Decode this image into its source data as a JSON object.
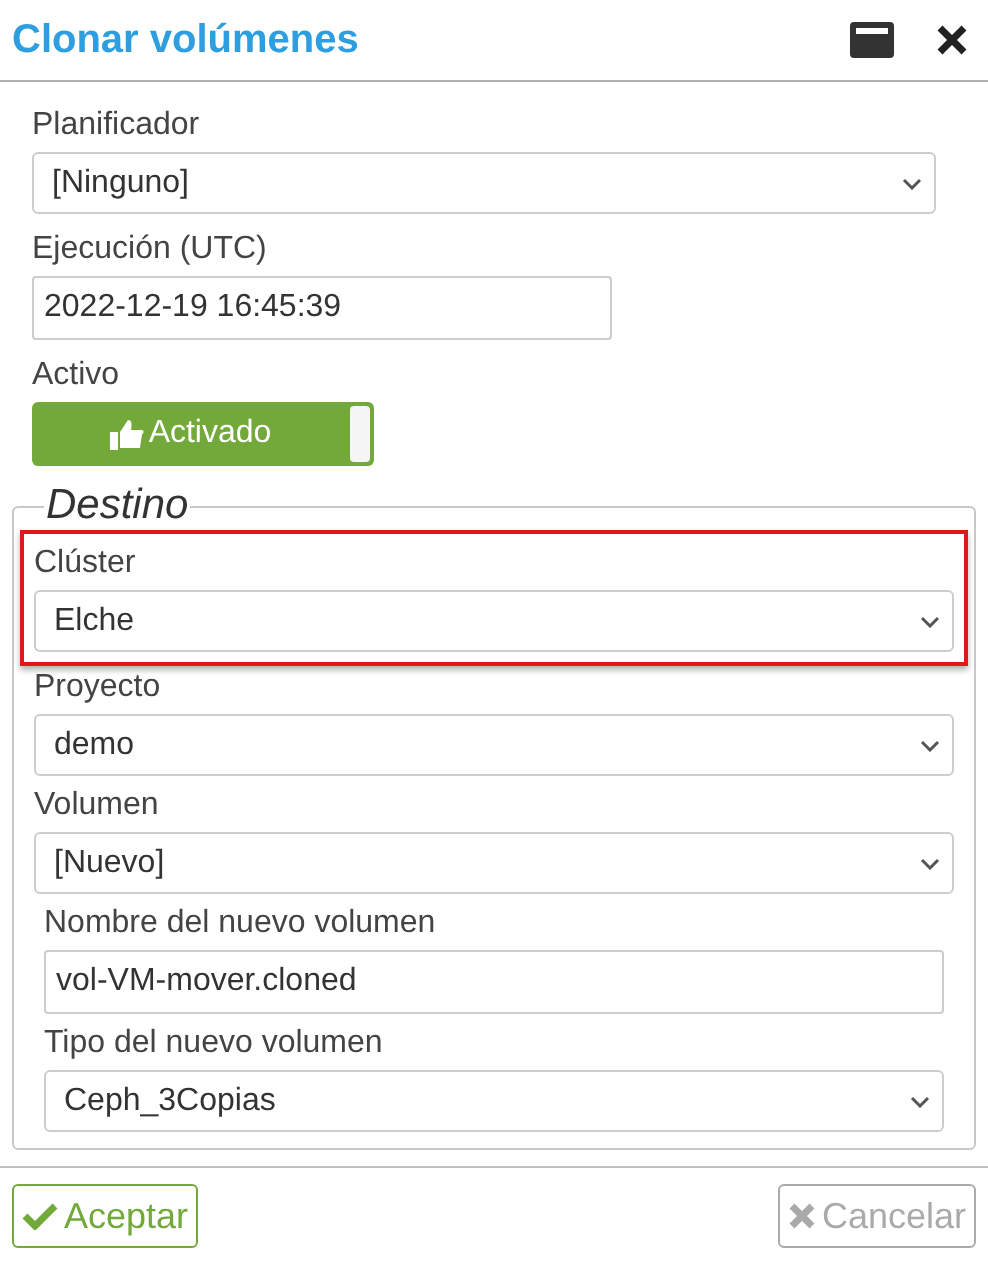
{
  "window": {
    "title": "Clonar volúmenes"
  },
  "fields": [
    {
      "kind": "select",
      "label": "Planificador",
      "value": "[Ninguno]"
    },
    {
      "kind": "input",
      "label": "Ejecución (UTC)",
      "value": "2022-12-19 16:45:39"
    },
    {
      "kind": "toggle",
      "label": "Activo",
      "value": "Activado",
      "on": true
    }
  ],
  "destino": {
    "legend": "Destino",
    "fields": [
      {
        "kind": "select",
        "label": "Clúster",
        "value": "Elche",
        "highlighted": true
      },
      {
        "kind": "select",
        "label": "Proyecto",
        "value": "demo",
        "highlighted": false
      },
      {
        "kind": "select",
        "label": "Volumen",
        "value": "[Nuevo]",
        "highlighted": false,
        "children": [
          {
            "kind": "input",
            "label": "Nombre del nuevo volumen",
            "value": "vol-VM-mover.cloned",
            "highlighted": false
          },
          {
            "kind": "select",
            "label": "Tipo del nuevo volumen",
            "value": "Ceph_3Copias",
            "highlighted": false
          }
        ]
      }
    ]
  },
  "buttons": [
    {
      "kind": "accept",
      "label": "Aceptar",
      "disabled": false
    },
    {
      "kind": "cancel",
      "label": "Cancelar",
      "disabled": true
    }
  ]
}
